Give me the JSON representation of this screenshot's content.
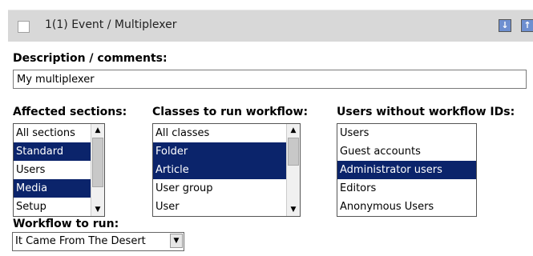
{
  "header": {
    "title": "1(1) Event / Multiplexer",
    "move_down_icon": "arrow-down-icon",
    "move_up_icon": "arrow-up-icon",
    "move_down_glyph": "↓",
    "move_up_glyph": "↑"
  },
  "description": {
    "label": "Description / comments:",
    "value": "My multiplexer"
  },
  "affected_sections": {
    "label": "Affected sections:",
    "options": [
      {
        "label": "All sections",
        "selected": false
      },
      {
        "label": "Standard",
        "selected": true
      },
      {
        "label": "Users",
        "selected": false
      },
      {
        "label": "Media",
        "selected": true
      },
      {
        "label": "Setup",
        "selected": false
      }
    ]
  },
  "classes": {
    "label": "Classes to run workflow:",
    "options": [
      {
        "label": "All classes",
        "selected": false
      },
      {
        "label": "Folder",
        "selected": true
      },
      {
        "label": "Article",
        "selected": true
      },
      {
        "label": "User group",
        "selected": false
      },
      {
        "label": "User",
        "selected": false
      }
    ]
  },
  "users_without_ids": {
    "label": "Users without workflow IDs:",
    "options": [
      {
        "label": "Users",
        "selected": false
      },
      {
        "label": "Guest accounts",
        "selected": false
      },
      {
        "label": "Administrator users",
        "selected": true
      },
      {
        "label": "Editors",
        "selected": false
      },
      {
        "label": "Anonymous Users",
        "selected": false
      }
    ]
  },
  "workflow": {
    "label": "Workflow to run:",
    "selected": "It Came From The Desert"
  },
  "colors": {
    "selection": "#0b246b",
    "header_bg": "#d8d8d8"
  }
}
